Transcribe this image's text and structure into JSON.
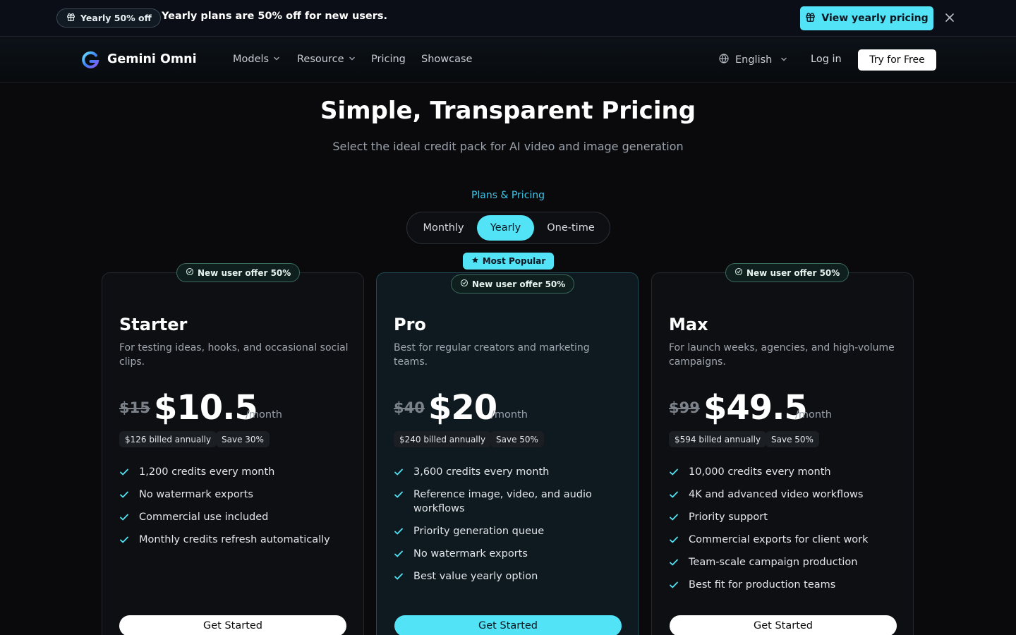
{
  "announcement": {
    "badge_label": "Yearly 50% off",
    "text": "Yearly plans are 50% off for new users.",
    "cta_label": "View yearly pricing"
  },
  "nav": {
    "brand": "Gemini Omni",
    "items": [
      {
        "label": "Models",
        "has_dropdown": true
      },
      {
        "label": "Resource",
        "has_dropdown": true
      },
      {
        "label": "Pricing",
        "has_dropdown": false
      },
      {
        "label": "Showcase",
        "has_dropdown": false
      }
    ],
    "language": "English",
    "login_label": "Log in",
    "cta_label": "Try for Free"
  },
  "hero": {
    "title": "Simple, Transparent Pricing",
    "subtitle": "Select the ideal credit pack for AI video and image generation",
    "section_label": "Plans & Pricing"
  },
  "billing_toggle": {
    "options": [
      "Monthly",
      "Yearly",
      "One-time"
    ],
    "selected": "Yearly"
  },
  "popular_label": "Most Popular",
  "plans": [
    {
      "offer_badge": "New user offer 50%",
      "name": "Starter",
      "description": "For testing ideas, hooks, and occasional social clips.",
      "original_price": "$15",
      "price": "$10.5",
      "period": "/month",
      "billed_note": "$126 billed annually",
      "savings": "Save 30%",
      "features": [
        "1,200 credits every month",
        "No watermark exports",
        "Commercial use included",
        "Monthly credits refresh automatically"
      ],
      "cta_label": "Get Started"
    },
    {
      "offer_badge": "New user offer 50%",
      "name": "Pro",
      "description": "Best for regular creators and marketing teams.",
      "original_price": "$40",
      "price": "$20",
      "period": "/month",
      "billed_note": "$240 billed annually",
      "savings": "Save 50%",
      "features": [
        "3,600 credits every month",
        "Reference image, video, and audio workflows",
        "Priority generation queue",
        "No watermark exports",
        "Best value yearly option"
      ],
      "cta_label": "Get Started"
    },
    {
      "offer_badge": "New user offer 50%",
      "name": "Max",
      "description": "For launch weeks, agencies, and high-volume campaigns.",
      "original_price": "$99",
      "price": "$49.5",
      "period": "/month",
      "billed_note": "$594 billed annually",
      "savings": "Save 50%",
      "features": [
        "10,000 credits every month",
        "4K and advanced video workflows",
        "Priority support",
        "Commercial exports for client work",
        "Team-scale campaign production",
        "Best fit for production teams"
      ],
      "cta_label": "Get Started"
    }
  ],
  "colors": {
    "accent": "#53e3f6",
    "background": "#0a0a0c",
    "offer_border": "#3c6a5c"
  },
  "icons": {
    "gift": "gift-icon",
    "close": "close-icon",
    "logo": "gemini-omni-logo",
    "chevron": "chevron-down-icon",
    "globe": "globe-icon",
    "star": "star-icon",
    "offer": "badge-check-icon",
    "check": "check-icon"
  }
}
